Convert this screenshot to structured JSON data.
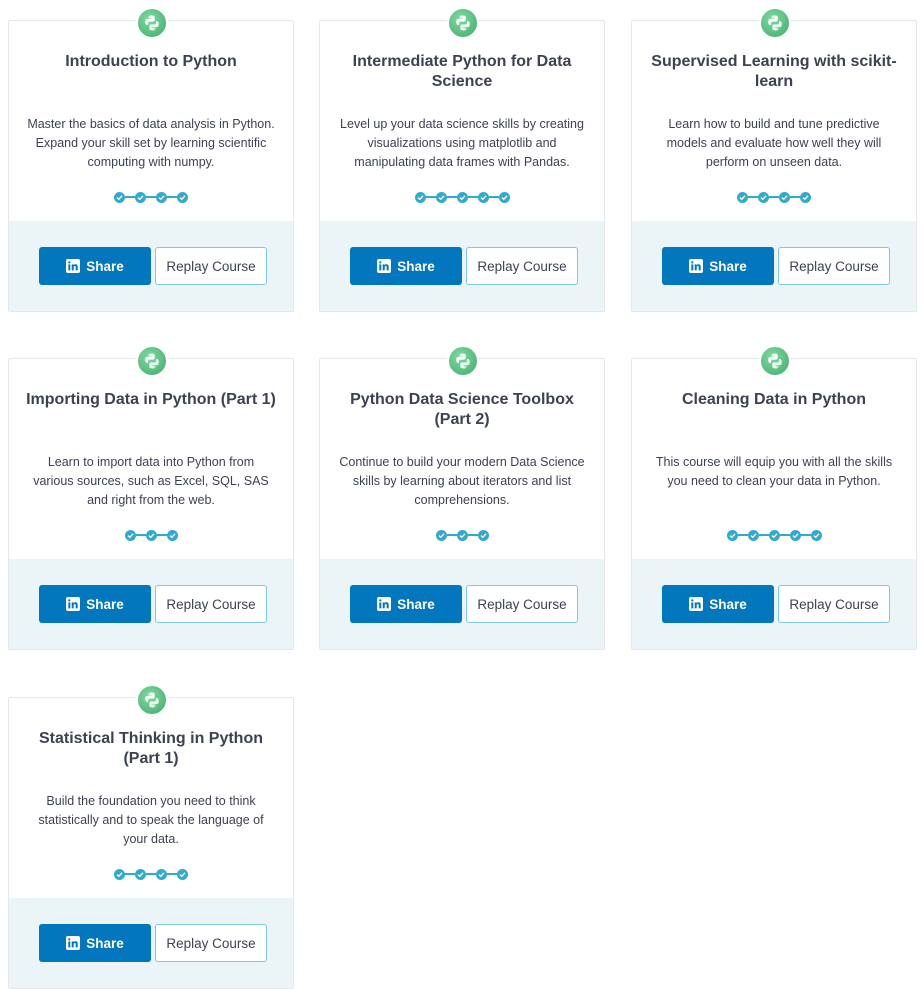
{
  "share_label": "Share",
  "replay_label": "Replay Course",
  "colors": {
    "share_button": "#0377bd",
    "progress": "#33aacc",
    "footer_background": "#ebf4f7",
    "course_icon": "#5cc083"
  },
  "courses": [
    {
      "title": "Introduction to Python",
      "description": "Master the basics of data analysis in Python. Expand your skill set by learning scientific computing with numpy.",
      "chapters": 4,
      "icon": "python-logo-icon"
    },
    {
      "title": "Intermediate Python for Data Science",
      "description": "Level up your data science skills by creating visualizations using matplotlib and manipulating data frames with Pandas.",
      "chapters": 5,
      "icon": "python-logo-icon"
    },
    {
      "title": "Supervised Learning with scikit-learn",
      "description": "Learn how to build and tune predictive models and evaluate how well they will perform on unseen data.",
      "chapters": 4,
      "icon": "python-logo-icon"
    },
    {
      "title": "Importing Data in Python (Part 1)",
      "description": "Learn to import data into Python from various sources, such as Excel, SQL, SAS and right from the web.",
      "chapters": 3,
      "icon": "python-logo-icon"
    },
    {
      "title": "Python Data Science Toolbox (Part 2)",
      "description": "Continue to build your modern Data Science skills by learning about iterators and list comprehensions.",
      "chapters": 3,
      "icon": "python-logo-icon"
    },
    {
      "title": "Cleaning Data in Python",
      "description": "This course will equip you with all the skills you need to clean your data in Python.",
      "chapters": 5,
      "icon": "python-logo-icon"
    },
    {
      "title": "Statistical Thinking in Python (Part 1)",
      "description": "Build the foundation you need to think statistically and to speak the language of your data.",
      "chapters": 4,
      "icon": "python-logo-icon"
    }
  ]
}
